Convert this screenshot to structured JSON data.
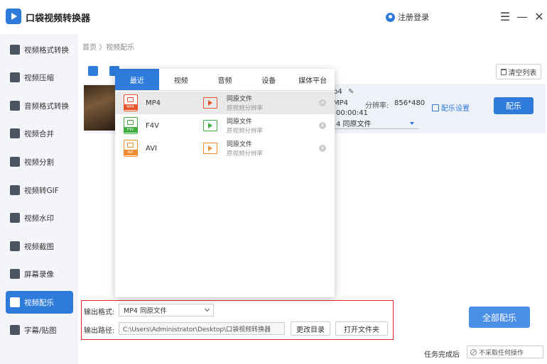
{
  "app": {
    "title": "口袋视频转换器",
    "login": "注册登录"
  },
  "window": {
    "menu_icon": "menu-icon",
    "minimize_icon": "minimize-icon",
    "close_icon": "close-icon"
  },
  "sidebar": {
    "items": [
      {
        "label": "视频格式转换",
        "active": false
      },
      {
        "label": "视频压缩",
        "active": false
      },
      {
        "label": "音频格式转换",
        "active": false
      },
      {
        "label": "视频合并",
        "active": false
      },
      {
        "label": "视频分割",
        "active": false
      },
      {
        "label": "视频转GIF",
        "active": false
      },
      {
        "label": "视频水印",
        "active": false
      },
      {
        "label": "视频截图",
        "active": false
      },
      {
        "label": "屏幕录像",
        "active": false
      },
      {
        "label": "视频配乐",
        "active": true
      },
      {
        "label": "字幕/贴图",
        "active": false
      }
    ]
  },
  "breadcrumb": "首页 〉视频配乐",
  "toolbar": {
    "clear_label": "清空列表"
  },
  "file": {
    "name": "p4",
    "format": "MP4",
    "resolution_label": "分辨率:",
    "resolution": "856*480",
    "duration": "00:00:41",
    "audio_track": "4  同原文件",
    "settings_label": "配乐设置",
    "action_label": "配乐"
  },
  "dropdown": {
    "tabs": [
      {
        "label": "最近",
        "active": true
      },
      {
        "label": "视频",
        "active": false
      },
      {
        "label": "音频",
        "active": false
      },
      {
        "label": "设备",
        "active": false
      },
      {
        "label": "媒体平台",
        "active": false
      }
    ],
    "formats": [
      {
        "name": "MP4",
        "tag": "MP4",
        "quality": "同原文件",
        "quality_sub": "原视频分辨率",
        "color": "#e8552c",
        "film_color": "#e8552c",
        "selected": true
      },
      {
        "name": "F4V",
        "tag": "F4V",
        "quality": "同原文件",
        "quality_sub": "原视频分辨率",
        "color": "#3fae3f",
        "film_color": "#3fae3f",
        "selected": false
      },
      {
        "name": "AVI",
        "tag": "AVI",
        "quality": "同原文件",
        "quality_sub": "原视频分辨率",
        "color": "#ef8a2e",
        "film_color": "#ef8a2e",
        "selected": false
      }
    ]
  },
  "output": {
    "format_label": "输出格式:",
    "format_value": "MP4  同原文件",
    "path_label": "输出路径:",
    "path_value": "C:\\Users\\Administrator\\Desktop\\口袋视频转换器",
    "change_dir_label": "更改目录",
    "open_folder_label": "打开文件夹"
  },
  "convert_all_label": "全部配乐",
  "task": {
    "label": "任务完成后",
    "value": "不采取任何操作"
  },
  "colors": {
    "accent": "#2f7bdc",
    "highlight_border": "#e0282a"
  }
}
